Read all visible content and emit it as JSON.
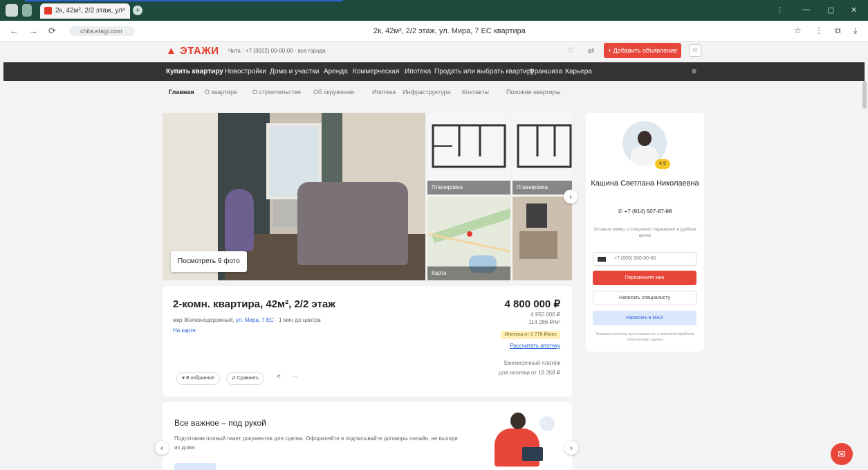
{
  "browser": {
    "tab_title": "2к, 42м², 2/2 этаж, ул",
    "tab_close": "×",
    "new_tab": "+",
    "url": "chita.etagi.com",
    "page_title": "2к, 42м², 2/2 этаж, ул. Мира, 7 ЕС квартира",
    "window_controls": [
      "⋮",
      "—",
      "▢",
      "✕"
    ],
    "nav": [
      "←",
      "→",
      "⟳",
      "⌂"
    ],
    "right_icons": [
      "☆",
      "⋮",
      "⧉",
      "⤓"
    ]
  },
  "header": {
    "logo": "ЭТАЖИ",
    "region": "Чита · +7 (3022) 00-00-00 · все города",
    "add_button": "+ Добавить объявление",
    "favorites_icon": "♡",
    "compare_icon": "⇄",
    "user_icon": "☺"
  },
  "main_nav": {
    "items": [
      "Купить квартиру",
      "Новостройки",
      "Дома и участки",
      "Аренда",
      "Коммерческая",
      "Ипотека",
      "Продать или выбрать квартиру",
      "Франшиза",
      "Карьера"
    ],
    "menu_icon": "≡"
  },
  "sub_nav": {
    "items": [
      "Главная",
      "О квартире",
      "О строительстве",
      "Об окружении",
      "Ипотека",
      "Инфраструктура",
      "Контакты",
      "Похожие квартиры"
    ]
  },
  "gallery": {
    "show_all": "Посмотреть 9 фото",
    "plan1_caption": "Планировка",
    "plan2_caption": "Планировка",
    "map_caption": "Карта",
    "next": "›"
  },
  "listing": {
    "title": "2-комн. квартира, 42м², 2/2 этаж",
    "address_prefix": "мкр Железнодорожный, ",
    "address_link": "ул. Мира, 7 ЕС",
    "address_suffix": " · 1 мин до центра",
    "on_map": "На карте",
    "price": "4 800 000 ₽",
    "price_old": "4 950 000 ₽",
    "price_per_m": "114 286 ₽/м²",
    "badge": "Ипотека от 3 776 ₽/мес",
    "calc_link": "Рассчитать ипотеку",
    "payment_line1": "Ежемесячный платёж",
    "payment_line2": "для ипотеки от 19 358 ₽",
    "action_favorite": "♥ В избранное",
    "action_compare": "⇄ Сравнить",
    "share_icon": "<",
    "more_icon": "⋯"
  },
  "promo": {
    "title": "Все важное – под рукой",
    "text": "Подготовим полный пакет документов для сделки. Оформляйте и подписывайте договоры онлайн, не выходя из дома",
    "prev": "‹",
    "next": "›"
  },
  "agent": {
    "rating": "4.9",
    "name": "Кашина Светлана Николаевна",
    "phone": "+7 (914) 507-87-98",
    "hint": "Оставьте номер, и специалист перезвонит в удобное время",
    "phone_placeholder": "+7 (000) 000-00-00",
    "call_button": "Перезвоните мне",
    "chat_button": "Написать специалисту",
    "max_button": "Написать в MAX",
    "legal": "Нажимая на кнопку, вы соглашаетесь с политикой обработки персональных данных"
  },
  "chat_fab": "✉",
  "colors": {
    "brand": "#e53a2b",
    "nav_bg": "#333333",
    "link": "#2a62d6"
  }
}
